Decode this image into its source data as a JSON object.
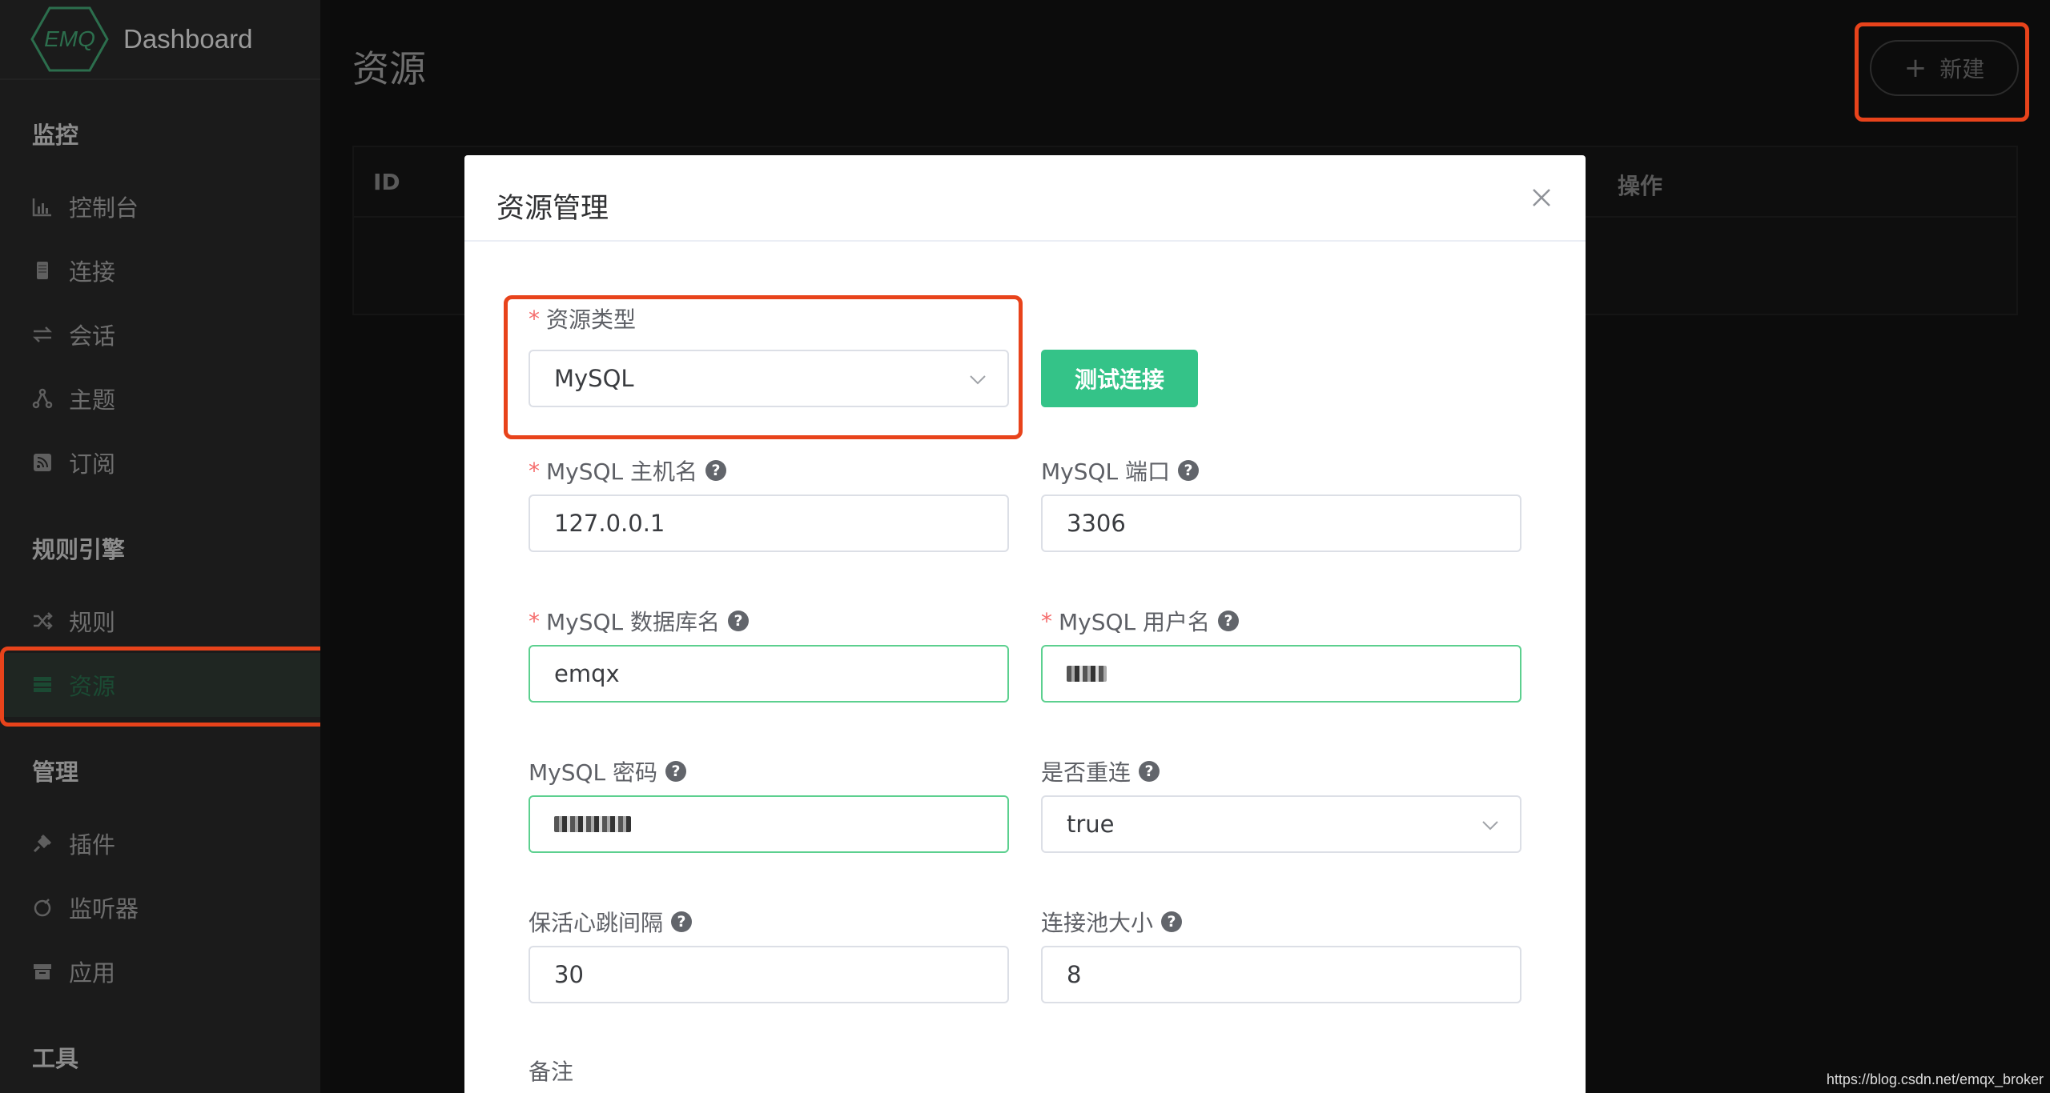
{
  "brand": {
    "logo_text": "EMQ",
    "title": "Dashboard"
  },
  "sidebar": {
    "sections": [
      {
        "title": "监控",
        "items": [
          {
            "label": "控制台",
            "icon": "bar-chart-icon"
          },
          {
            "label": "连接",
            "icon": "device-icon"
          },
          {
            "label": "会话",
            "icon": "swap-icon"
          },
          {
            "label": "主题",
            "icon": "topic-icon"
          },
          {
            "label": "订阅",
            "icon": "rss-icon"
          }
        ]
      },
      {
        "title": "规则引擎",
        "items": [
          {
            "label": "规则",
            "icon": "shuffle-icon"
          },
          {
            "label": "资源",
            "icon": "database-icon",
            "active": true
          }
        ]
      },
      {
        "title": "管理",
        "items": [
          {
            "label": "插件",
            "icon": "plug-icon"
          },
          {
            "label": "监听器",
            "icon": "listener-icon"
          },
          {
            "label": "应用",
            "icon": "box-icon"
          }
        ]
      },
      {
        "title": "工具",
        "items": []
      }
    ]
  },
  "main": {
    "page_title": "资源",
    "new_button": "新建",
    "table": {
      "col_id": "ID",
      "col_actions": "操作"
    }
  },
  "modal": {
    "title": "资源管理",
    "test_button": "测试连接",
    "fields": {
      "resource_type": {
        "label": "资源类型",
        "value": "MySQL"
      },
      "host": {
        "label": "MySQL 主机名",
        "value": "127.0.0.1"
      },
      "port": {
        "label": "MySQL 端口",
        "value": "3306"
      },
      "database": {
        "label": "MySQL 数据库名",
        "value": "emqx"
      },
      "username": {
        "label": "MySQL 用户名",
        "value": ""
      },
      "password": {
        "label": "MySQL 密码",
        "value": ""
      },
      "auto_reconnect": {
        "label": "是否重连",
        "value": "true"
      },
      "keepalive": {
        "label": "保活心跳间隔",
        "value": "30"
      },
      "pool_size": {
        "label": "连接池大小",
        "value": "8"
      },
      "description": {
        "label": "备注"
      }
    }
  },
  "colors": {
    "highlight": "#e8431b",
    "accent_green": "#34c388",
    "required": "#f56c6c"
  },
  "watermark": "https://blog.csdn.net/emqx_broker"
}
